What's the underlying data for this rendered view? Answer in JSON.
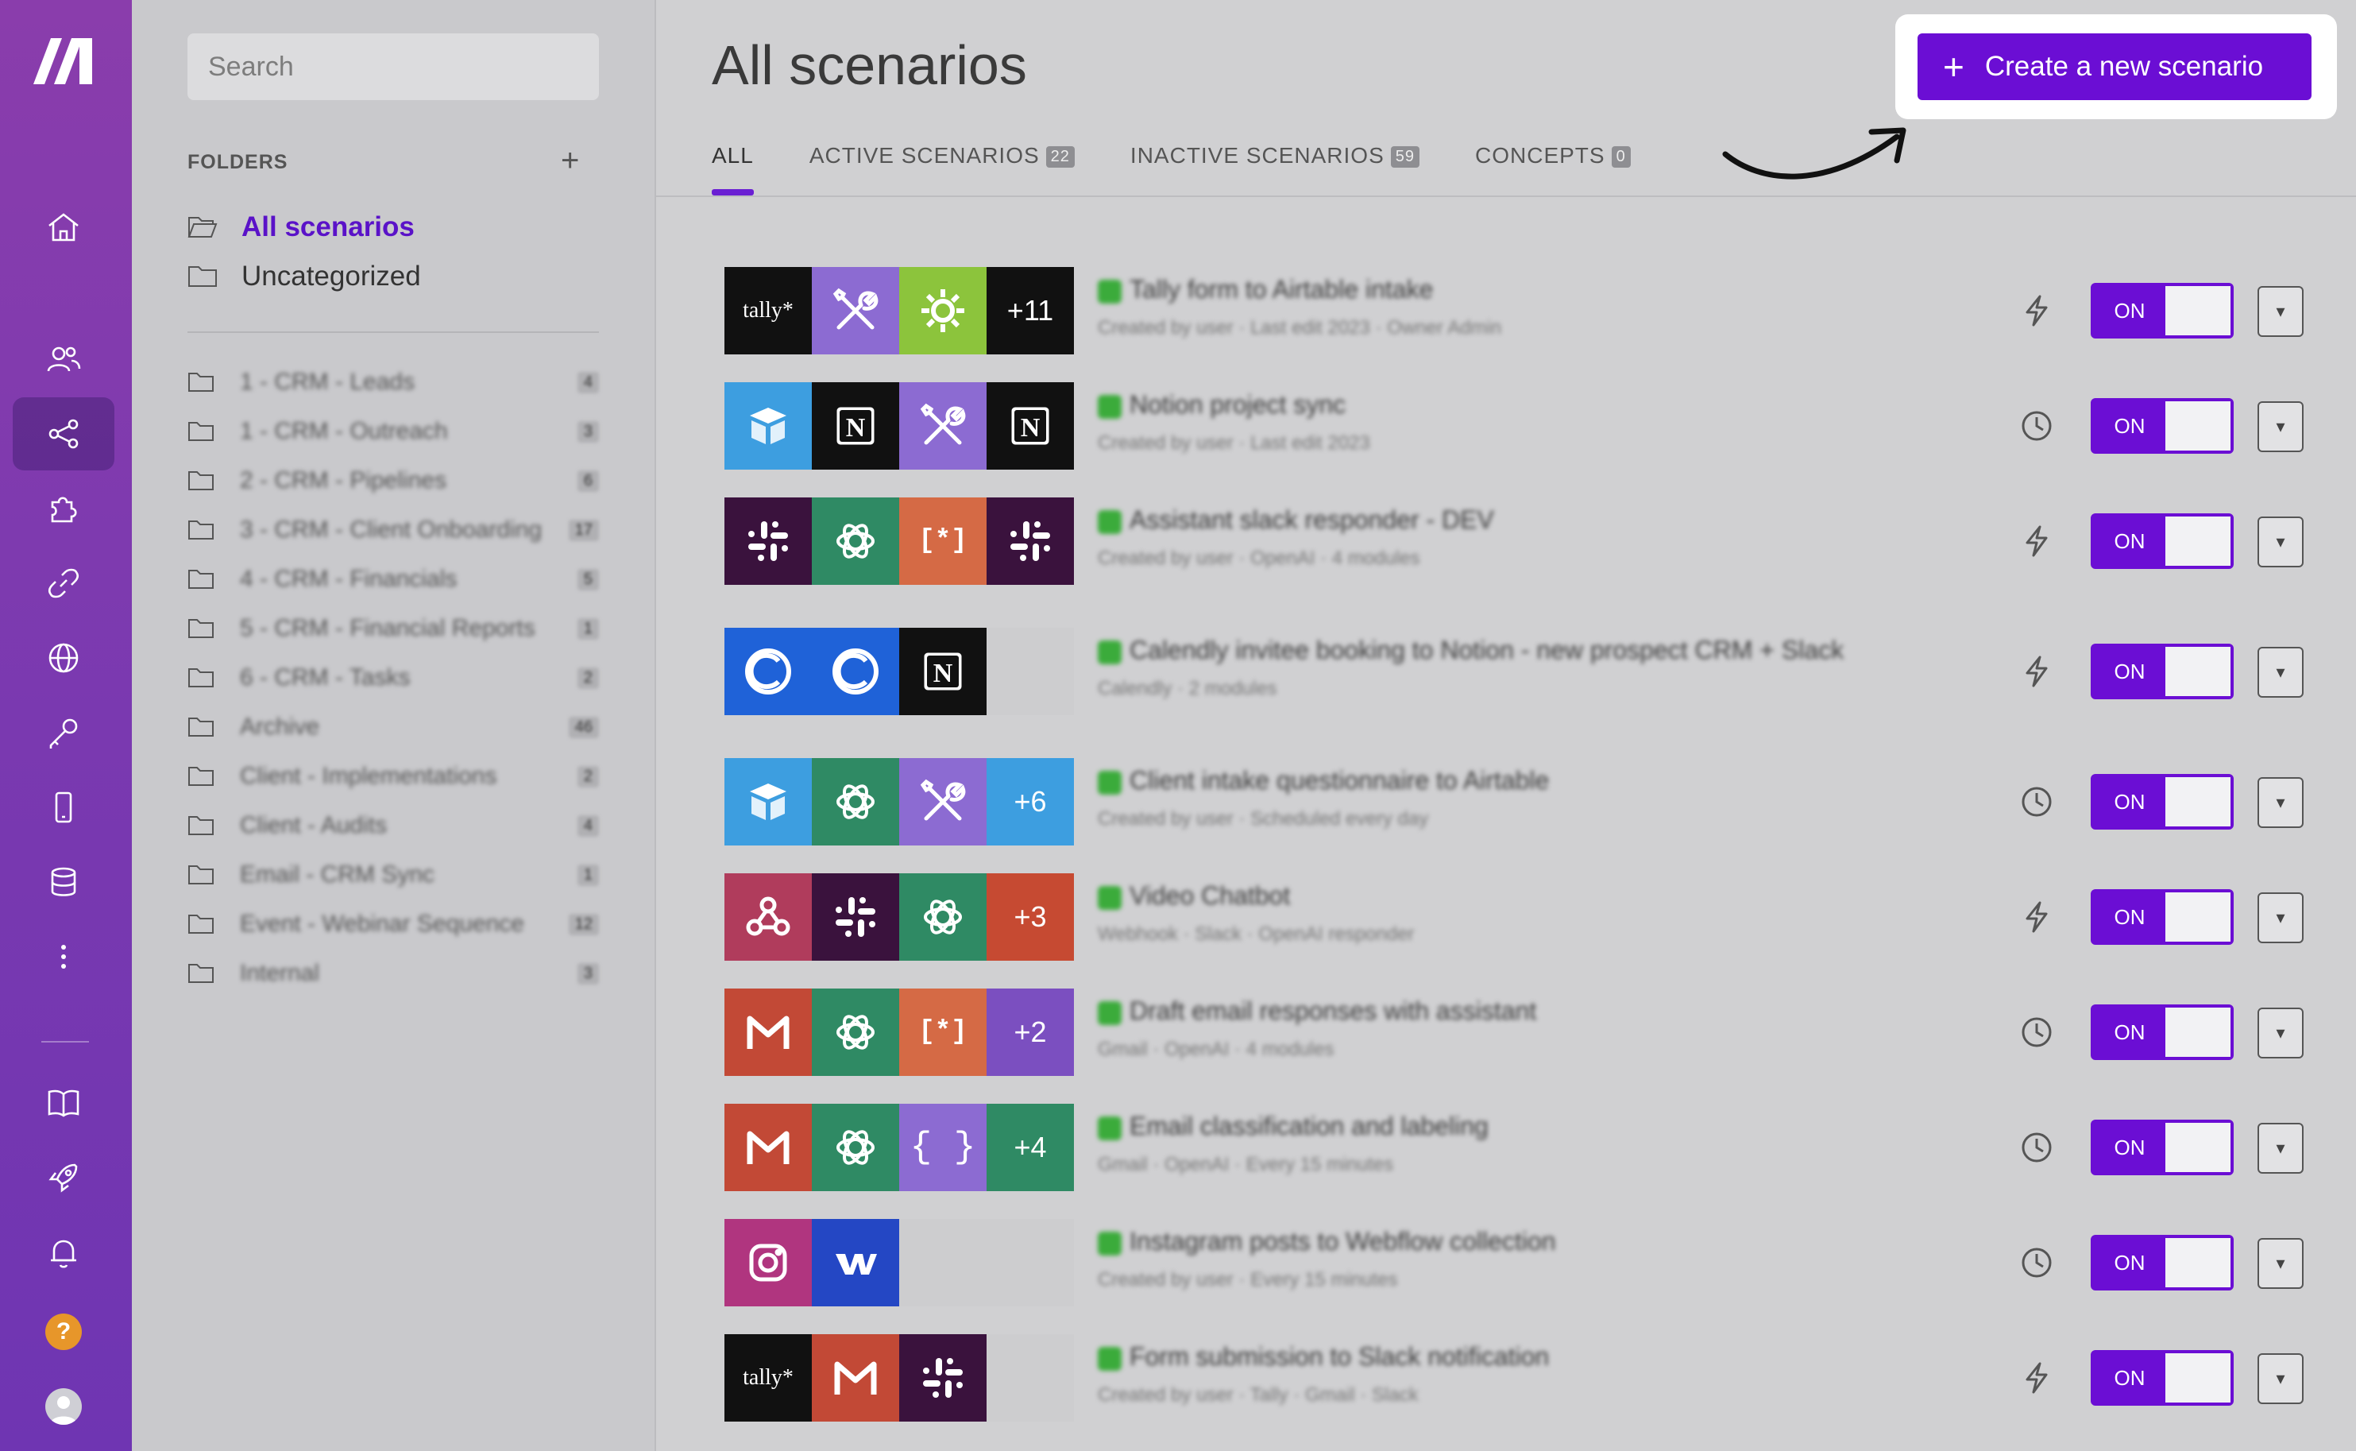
{
  "search": {
    "placeholder": "Search"
  },
  "folders": {
    "header": "FOLDERS",
    "add": "+",
    "top": [
      {
        "label": "All scenarios",
        "active": true
      },
      {
        "label": "Uncategorized",
        "active": false
      }
    ],
    "items": [
      {
        "label": "1 - CRM - Leads",
        "count": "4"
      },
      {
        "label": "1 - CRM - Outreach",
        "count": "3"
      },
      {
        "label": "2 - CRM - Pipelines",
        "count": "6"
      },
      {
        "label": "3 - CRM - Client Onboarding",
        "count": "17"
      },
      {
        "label": "4 - CRM - Financials",
        "count": "5"
      },
      {
        "label": "5 - CRM - Financial Reports",
        "count": "1"
      },
      {
        "label": "6 - CRM - Tasks",
        "count": "2"
      },
      {
        "label": "Archive",
        "count": "46"
      },
      {
        "label": "Client - Implementations",
        "count": "2"
      },
      {
        "label": "Client - Audits",
        "count": "4"
      },
      {
        "label": "Email - CRM Sync",
        "count": "1"
      },
      {
        "label": "Event - Webinar Sequence",
        "count": "12"
      },
      {
        "label": "Internal",
        "count": "3"
      }
    ]
  },
  "main": {
    "title": "All scenarios",
    "create_button": "Create a new scenario",
    "tabs": [
      {
        "label": "ALL",
        "count": "",
        "active": true
      },
      {
        "label": "ACTIVE SCENARIOS",
        "count": "22",
        "active": false
      },
      {
        "label": "INACTIVE SCENARIOS",
        "count": "59",
        "active": false
      },
      {
        "label": "CONCEPTS",
        "count": "0",
        "active": false
      }
    ]
  },
  "scenarios": [
    {
      "title": "Tally form to Airtable intake",
      "subtitle": "Created by user  ·  Last edit 2023  ·  Owner Admin",
      "trigger": "instant",
      "state": "ON",
      "icons": [
        {
          "app": "tally",
          "color": "#111111"
        },
        {
          "app": "tools",
          "color": "#8c6bd2"
        },
        {
          "app": "gear",
          "color": "#8cc43c"
        },
        {
          "app": "more",
          "color": "#111111",
          "text": "+11"
        }
      ]
    },
    {
      "title": "Notion project sync",
      "subtitle": "Created by user  ·  Last edit 2023",
      "trigger": "scheduled",
      "state": "ON",
      "icons": [
        {
          "app": "airtable",
          "color": "#3d9ee0"
        },
        {
          "app": "notion",
          "color": "#111111"
        },
        {
          "app": "tools",
          "color": "#8c6bd2"
        },
        {
          "app": "notion",
          "color": "#111111"
        }
      ]
    },
    {
      "title": "Assistant slack responder - DEV",
      "subtitle": "Created by user  ·  OpenAI  ·  4 modules",
      "trigger": "instant",
      "state": "ON",
      "icons": [
        {
          "app": "slack",
          "color": "#3a123d"
        },
        {
          "app": "openai",
          "color": "#2f8a64"
        },
        {
          "app": "json",
          "color": "#d56a45"
        },
        {
          "app": "slack",
          "color": "#3a123d"
        }
      ]
    },
    {
      "title": "Calendly invitee booking to Notion - new prospect CRM + Slack",
      "subtitle": "Calendly  ·  2 modules",
      "trigger": "instant",
      "state": "ON",
      "icons": [
        {
          "app": "calendly",
          "color": "#1f62d8"
        },
        {
          "app": "calendly",
          "color": "#1f62d8"
        },
        {
          "app": "notion",
          "color": "#111111"
        },
        {
          "app": "empty",
          "color": "#cdcdcf"
        }
      ]
    },
    {
      "title": "Client intake questionnaire to Airtable",
      "subtitle": "Created by user  ·  Scheduled every day",
      "trigger": "scheduled",
      "state": "ON",
      "icons": [
        {
          "app": "airtable",
          "color": "#3d9ee0"
        },
        {
          "app": "openai",
          "color": "#2f8a64"
        },
        {
          "app": "tools",
          "color": "#8c6bd2"
        },
        {
          "app": "more",
          "color": "#3d9ee0",
          "text": "+6"
        }
      ]
    },
    {
      "title": "Video Chatbot",
      "subtitle": "Webhook  ·  Slack  ·  OpenAI responder",
      "trigger": "instant",
      "state": "ON",
      "icons": [
        {
          "app": "webhook",
          "color": "#b03c5c"
        },
        {
          "app": "slack",
          "color": "#3a123d"
        },
        {
          "app": "openai",
          "color": "#2f8a64"
        },
        {
          "app": "more",
          "color": "#c64a32",
          "text": "+3"
        }
      ]
    },
    {
      "title": "Draft email responses with assistant",
      "subtitle": "Gmail  ·  OpenAI  ·  4 modules",
      "trigger": "scheduled",
      "state": "ON",
      "icons": [
        {
          "app": "gmail",
          "color": "#c24936"
        },
        {
          "app": "openai",
          "color": "#2f8a64"
        },
        {
          "app": "json",
          "color": "#d56a45"
        },
        {
          "app": "more",
          "color": "#7b4fc0",
          "text": "+2"
        }
      ]
    },
    {
      "title": "Email classification and labeling",
      "subtitle": "Gmail  ·  OpenAI  ·  Every 15 minutes",
      "trigger": "scheduled",
      "state": "ON",
      "icons": [
        {
          "app": "gmail",
          "color": "#c24936"
        },
        {
          "app": "openai",
          "color": "#2f8a64"
        },
        {
          "app": "braces",
          "color": "#8c6bd2"
        },
        {
          "app": "more",
          "color": "#2f8a64",
          "text": "+4"
        }
      ]
    },
    {
      "title": "Instagram posts to Webflow collection",
      "subtitle": "Created by user  ·  Every 15 minutes",
      "trigger": "scheduled",
      "state": "ON",
      "icons": [
        {
          "app": "instagram",
          "color": "#b0357f"
        },
        {
          "app": "webflow",
          "color": "#2447c4"
        },
        {
          "app": "empty",
          "color": "#cdcdcf"
        },
        {
          "app": "empty",
          "color": "#cdcdcf"
        }
      ]
    },
    {
      "title": "Form submission to Slack notification",
      "subtitle": "Created by user  ·  Tally  ·  Gmail  ·  Slack",
      "trigger": "instant",
      "state": "ON",
      "icons": [
        {
          "app": "tally",
          "color": "#111111"
        },
        {
          "app": "gmail",
          "color": "#c24936"
        },
        {
          "app": "slack",
          "color": "#3a123d"
        },
        {
          "app": "empty",
          "color": "#cdcdcf"
        }
      ]
    }
  ],
  "colors": {
    "accent": "#6b0ed4",
    "rail": "#7a39b0",
    "status_green": "#3bab3b"
  }
}
